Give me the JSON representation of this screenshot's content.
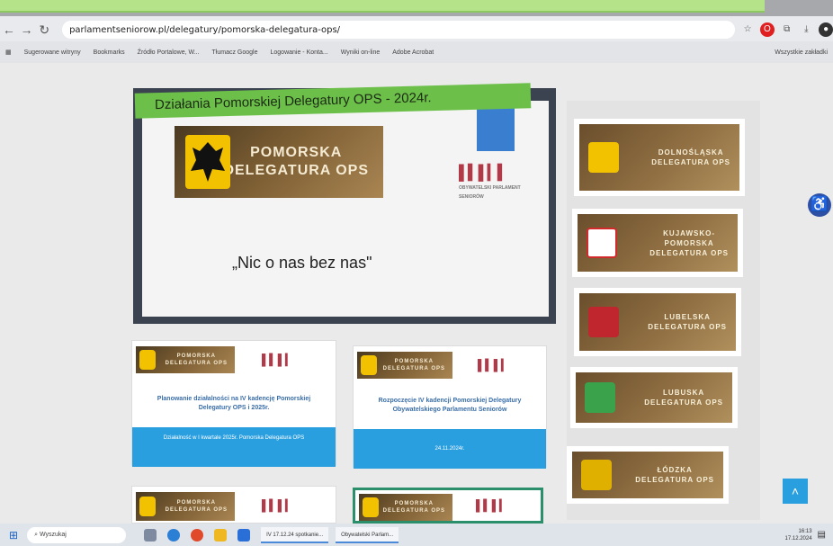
{
  "browser": {
    "url": "parlamentseniorow.pl/delegatury/pomorska-delegatura-ops/",
    "bookmarks": [
      "Sugerowane witryny",
      "Bookmarks",
      "Źródło Portalowe, W...",
      "Tłumacz Google",
      "Logowanie - Konta...",
      "Wyniki on-line",
      "Adobe Acrobat"
    ],
    "all_bookmarks": "Wszystkie zakładki"
  },
  "slide": {
    "title": "Działania Pomorskiej Delegatury OPS - 2024r.",
    "banner_line1": "POMORSKA",
    "banner_line2": "DELEGATURA OPS",
    "logo_text": "OBYWATELSKI PARLAMENT SENIORÓW",
    "slogan": "„Nic o nas bez nas\""
  },
  "cards": [
    {
      "banner1": "POMORSKA",
      "banner2": "DELEGATURA OPS",
      "title": "Planowanie działalności na IV kadencję Pomorskiej Delegatury OPS i 2025r.",
      "footer": "Działalność w I kwartale 2025r. Pomorska Delegatura OPS"
    },
    {
      "banner1": "POMORSKA",
      "banner2": "DELEGATURA OPS",
      "title": "Rozpoczęcie IV kadencji Pomorskiej Delegatury Obywatelskiego Parlamentu Seniorów",
      "footer": "24.11.2024r."
    },
    {
      "banner1": "POMORSKA",
      "banner2": "DELEGATURA OPS"
    },
    {
      "banner1": "POMORSKA",
      "banner2": "DELEGATURA OPS"
    }
  ],
  "delegatury": [
    {
      "line1": "DOLNOŚLĄSKA",
      "line2": "DELEGATURA OPS",
      "color": "#f2c200"
    },
    {
      "line1": "KUJAWSKO-",
      "line2": "POMORSKA",
      "line3": "DELEGATURA OPS",
      "color": "#d22a2a"
    },
    {
      "line1": "LUBELSKA",
      "line2": "DELEGATURA OPS",
      "color": "#c0262e"
    },
    {
      "line1": "LUBUSKA",
      "line2": "DELEGATURA OPS",
      "color": "#3aa24a"
    },
    {
      "line1": "ŁÓDZKA",
      "line2": "DELEGATURA OPS",
      "color": "#e0b000"
    }
  ],
  "taskbar": {
    "search": "Wyszukaj",
    "apps": [
      "IV 17.12.24 spotkanie...",
      "Obywatelski Parlam..."
    ],
    "time": "16:13",
    "date": "17.12.2024"
  },
  "colors": {
    "accent_green": "#6cc04a",
    "accent_blue": "#2a9fe0",
    "a11y_blue": "#2d4fa4"
  }
}
